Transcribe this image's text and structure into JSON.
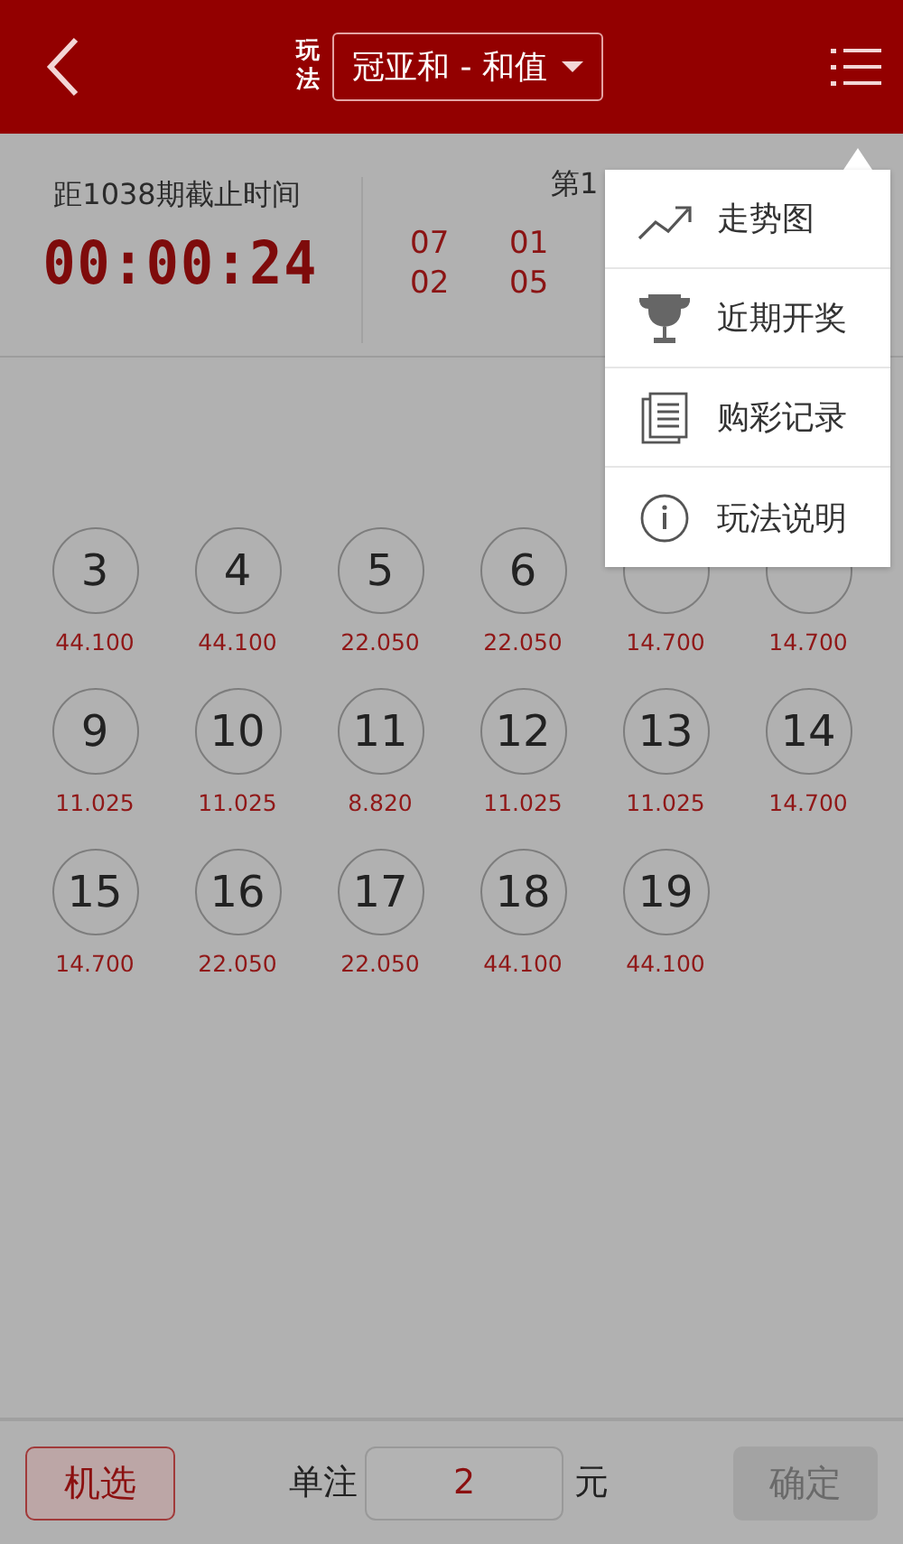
{
  "header": {
    "play_label": "玩法",
    "play_type": "冠亚和 - 和值"
  },
  "countdown": {
    "label": "距1038期截止时间",
    "time": "00:00:24"
  },
  "last_draw": {
    "title": "第1",
    "numbers": [
      "07",
      "01",
      "02",
      "05"
    ]
  },
  "balls": [
    {
      "number": "3",
      "odds": "44.100"
    },
    {
      "number": "4",
      "odds": "44.100"
    },
    {
      "number": "5",
      "odds": "22.050"
    },
    {
      "number": "6",
      "odds": "22.050"
    },
    {
      "odds": "14.700"
    },
    {
      "odds": "14.700"
    },
    {
      "number": "9",
      "odds": "11.025"
    },
    {
      "number": "10",
      "odds": "11.025"
    },
    {
      "number": "11",
      "odds": "8.820"
    },
    {
      "number": "12",
      "odds": "11.025"
    },
    {
      "number": "13",
      "odds": "11.025"
    },
    {
      "number": "14",
      "odds": "14.700"
    },
    {
      "number": "15",
      "odds": "14.700"
    },
    {
      "number": "16",
      "odds": "22.050"
    },
    {
      "number": "17",
      "odds": "22.050"
    },
    {
      "number": "18",
      "odds": "44.100"
    },
    {
      "number": "19",
      "odds": "44.100"
    }
  ],
  "menu": {
    "items": [
      {
        "kind": "trend",
        "label": "走势图"
      },
      {
        "kind": "trophy",
        "label": "近期开奖"
      },
      {
        "kind": "record",
        "label": "购彩记录"
      },
      {
        "kind": "info",
        "label": "玩法说明"
      }
    ]
  },
  "bottom": {
    "random_button": "机选",
    "bet_label": "单注",
    "amount": "2",
    "unit": "元",
    "confirm_button": "确定"
  }
}
